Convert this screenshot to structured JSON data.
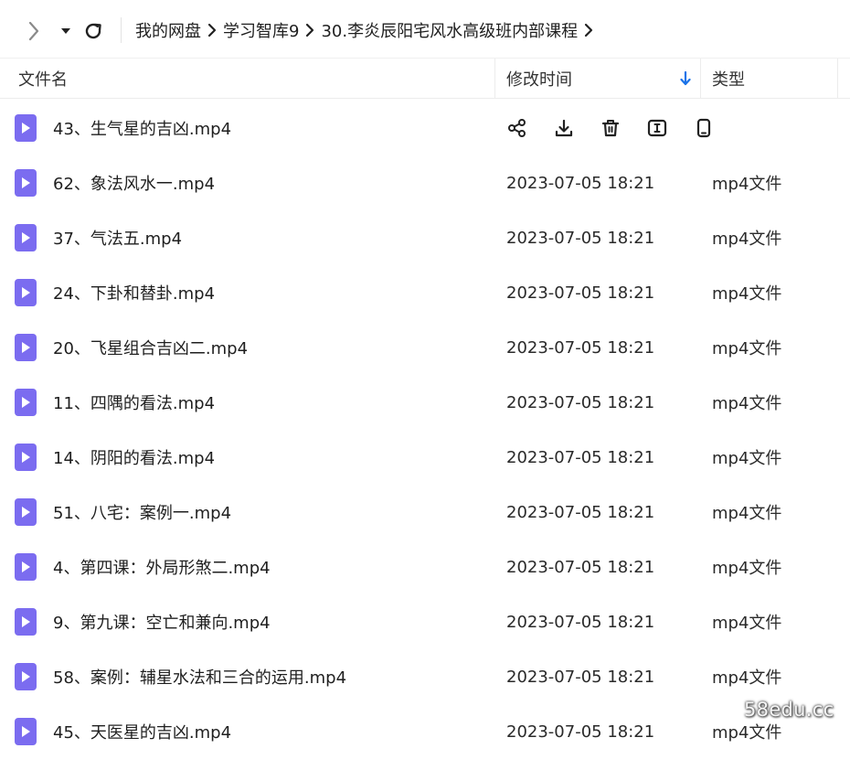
{
  "toolbar": {
    "forward_icon": "chevron-right-icon",
    "dropdown_icon": "caret-down-icon",
    "refresh_icon": "refresh-icon"
  },
  "breadcrumb": [
    "我的网盘",
    "学习智库9",
    "30.李炎辰阳宅风水高级班内部课程"
  ],
  "columns": {
    "name": "文件名",
    "time": "修改时间",
    "type": "类型"
  },
  "sort": {
    "column": "修改时间",
    "direction": "down",
    "color": "#1a73e8"
  },
  "row_actions": [
    "share-icon",
    "download-icon",
    "delete-icon",
    "rename-icon",
    "mobile-icon"
  ],
  "files": [
    {
      "name": "43、生气星的吉凶.mp4",
      "time": "",
      "type": "",
      "hovered": true
    },
    {
      "name": "62、象法风水一.mp4",
      "time": "2023-07-05 18:21",
      "type": "mp4文件"
    },
    {
      "name": "37、气法五.mp4",
      "time": "2023-07-05 18:21",
      "type": "mp4文件"
    },
    {
      "name": "24、下卦和替卦.mp4",
      "time": "2023-07-05 18:21",
      "type": "mp4文件"
    },
    {
      "name": "20、飞星组合吉凶二.mp4",
      "time": "2023-07-05 18:21",
      "type": "mp4文件"
    },
    {
      "name": "11、四隅的看法.mp4",
      "time": "2023-07-05 18:21",
      "type": "mp4文件"
    },
    {
      "name": "14、阴阳的看法.mp4",
      "time": "2023-07-05 18:21",
      "type": "mp4文件"
    },
    {
      "name": "51、八宅：案例一.mp4",
      "time": "2023-07-05 18:21",
      "type": "mp4文件"
    },
    {
      "name": "4、第四课：外局形煞二.mp4",
      "time": "2023-07-05 18:21",
      "type": "mp4文件"
    },
    {
      "name": "9、第九课：空亡和兼向.mp4",
      "time": "2023-07-05 18:21",
      "type": "mp4文件"
    },
    {
      "name": "58、案例：辅星水法和三合的运用.mp4",
      "time": "2023-07-05 18:21",
      "type": "mp4文件"
    },
    {
      "name": "45、天医星的吉凶.mp4",
      "time": "2023-07-05 18:21",
      "type": "mp4文件"
    }
  ],
  "file_icon_color": "#7b6cf0",
  "watermark": "58edu.cc"
}
